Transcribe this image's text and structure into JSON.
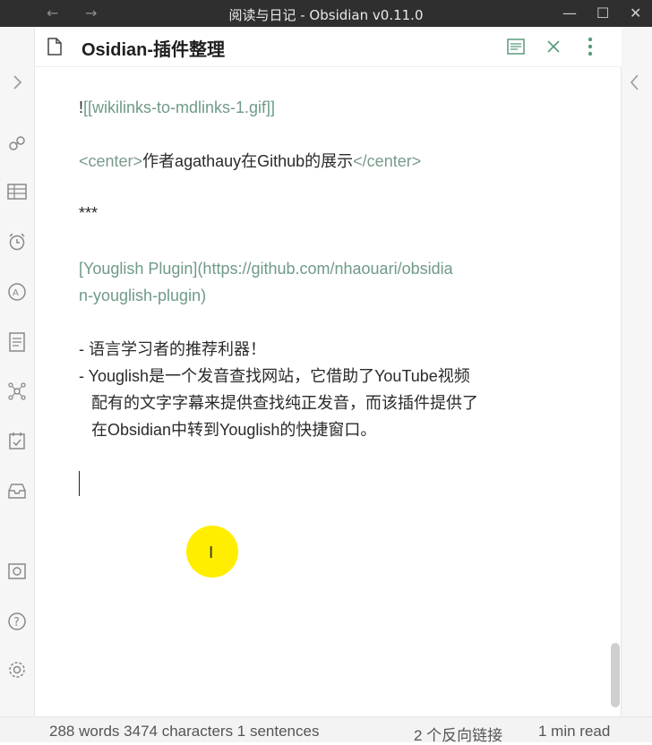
{
  "titlebar": {
    "title": "阅读与日记 - Obsidian v0.11.0",
    "back": "←",
    "forward": "→",
    "minimize": "—",
    "maximize": "☐",
    "close": "✕"
  },
  "pane": {
    "title": "Osidian-插件整理"
  },
  "editor": {
    "line1_prefix": "!",
    "line1_link": "[[wikilinks-to-mdlinks-1.gif]]",
    "line2_open": "<center>",
    "line2_text": "作者agathauy在Github的展示",
    "line2_close": "</center>",
    "line3": "***",
    "line4_link": "[Youglish Plugin]",
    "line4_url_a": "(https://github.com/nhaouari/obsidia",
    "line4_url_b": "n-youglish-plugin)",
    "bullet1": "- 语言学习者的推荐利器！",
    "bullet2_a": "- Youglish是一个发音查找网站，它借助了YouTube视频",
    "bullet2_b": "配有的文字字幕来提供查找纯正发音，而该插件提供了",
    "bullet2_c": "在Obsidian中转到Youglish的快捷窗口。"
  },
  "cursor_icon": "I",
  "status": {
    "words": "288 words 3474 characters 1 sentences",
    "backlinks": "2 个反向链接",
    "read_time": "1 min read"
  },
  "icons": {
    "left_collapse": "chevron-right-icon",
    "right_collapse": "chevron-left-icon"
  }
}
